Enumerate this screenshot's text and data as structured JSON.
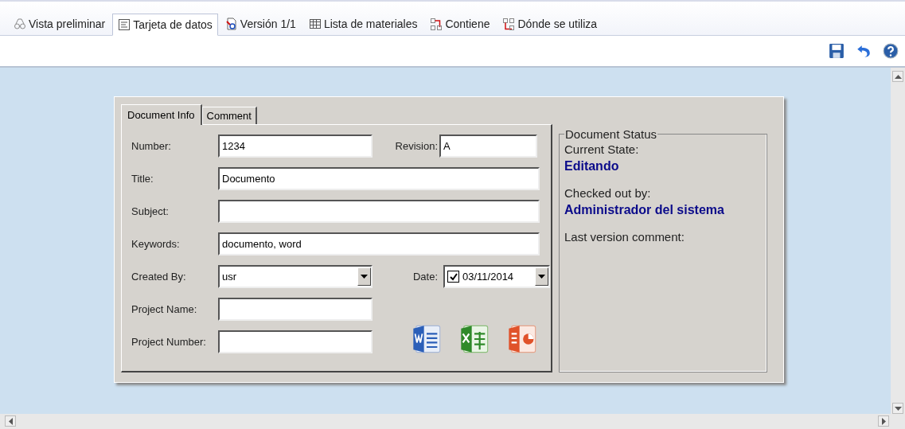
{
  "tabs": [
    {
      "label": "Vista preliminar",
      "kind": "preview",
      "selected": false
    },
    {
      "label": "Tarjeta de datos",
      "kind": "card",
      "selected": true
    },
    {
      "label": "Versión 1/1",
      "kind": "version",
      "selected": false
    },
    {
      "label": "Lista de materiales",
      "kind": "list",
      "selected": false
    },
    {
      "label": "Contiene",
      "kind": "contains",
      "selected": false
    },
    {
      "label": "Dónde se utiliza",
      "kind": "whereused",
      "selected": false
    }
  ],
  "form_tabs": [
    {
      "label": "Document Info",
      "selected": true
    },
    {
      "label": "Comment",
      "selected": false
    }
  ],
  "rows": [
    {
      "fields": [
        {
          "kind": "short",
          "label": "Number:",
          "value": "1234"
        },
        {
          "kind": "short",
          "label": "Revision:",
          "value": "A"
        }
      ]
    },
    {
      "fields": [
        {
          "kind": "wide",
          "label": "Title:",
          "value": "Documento"
        }
      ]
    },
    {
      "fields": [
        {
          "kind": "wide",
          "label": "Subject:"
        }
      ]
    },
    {
      "fields": [
        {
          "kind": "wide",
          "label": "Keywords:",
          "value": "documento, word"
        }
      ]
    },
    {
      "fields": [
        {
          "kind": "combo",
          "label": "Created By:",
          "value": "usr"
        },
        {
          "kind": "date",
          "label": "Date:",
          "value": "03/11/2014",
          "checked": true
        }
      ]
    },
    {
      "fields": [
        {
          "kind": "short",
          "label": "Project Name:"
        }
      ]
    },
    {
      "fields": [
        {
          "kind": "short",
          "label": "Project Number:"
        }
      ]
    }
  ],
  "status": {
    "title": "Document Status",
    "items": [
      {
        "label": "Current State:",
        "value": "Editando"
      },
      {
        "label": "Checked out by:",
        "value": "Administrador del sistema"
      },
      {
        "label": "Last version comment:"
      }
    ]
  }
}
